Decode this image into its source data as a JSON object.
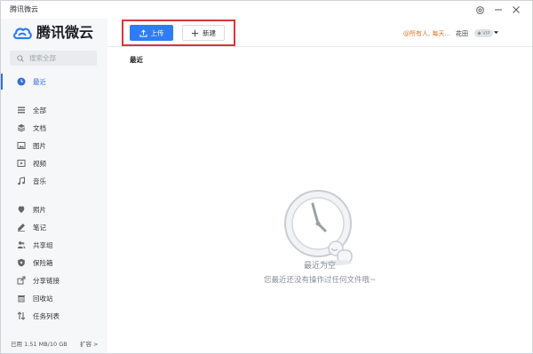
{
  "app": {
    "title": "腾讯微云",
    "logo_text": "腾讯微云"
  },
  "search": {
    "placeholder": "搜索全部"
  },
  "sidebar": {
    "items": [
      {
        "id": "recent",
        "label": "最近",
        "icon": "clock-icon",
        "active": true
      },
      {
        "id": "all",
        "label": "全部",
        "icon": "list-icon"
      },
      {
        "id": "docs",
        "label": "文档",
        "icon": "layers-icon"
      },
      {
        "id": "images",
        "label": "图片",
        "icon": "image-icon"
      },
      {
        "id": "video",
        "label": "视频",
        "icon": "video-icon"
      },
      {
        "id": "music",
        "label": "音乐",
        "icon": "music-icon"
      },
      {
        "id": "photos",
        "label": "照片",
        "icon": "leaf-icon"
      },
      {
        "id": "notes",
        "label": "笔记",
        "icon": "pen-icon"
      },
      {
        "id": "share-group",
        "label": "共享组",
        "icon": "users-icon"
      },
      {
        "id": "vault",
        "label": "保险箱",
        "icon": "shield-icon"
      },
      {
        "id": "share-link",
        "label": "分享链接",
        "icon": "share-icon"
      },
      {
        "id": "trash",
        "label": "回收站",
        "icon": "trash-icon"
      },
      {
        "id": "tasks",
        "label": "任务列表",
        "icon": "transfer-icon"
      }
    ]
  },
  "storage": {
    "usage": "已用 1.51 MB/10 GB",
    "expand_label": "扩容 >"
  },
  "toolbar": {
    "upload_label": "上传",
    "new_label": "新建"
  },
  "header": {
    "notice": "@所有人, 每天...",
    "user_name": "花田",
    "vip_badge": "VIP"
  },
  "main": {
    "section_title": "最近",
    "empty_title": "最近为空",
    "empty_subtitle": "您最近还没有操作过任何文件哦~"
  },
  "colors": {
    "accent": "#2f7cf6",
    "active_nav": "#2f6fde",
    "notice": "#e0752b",
    "highlight": "#d9343c"
  }
}
